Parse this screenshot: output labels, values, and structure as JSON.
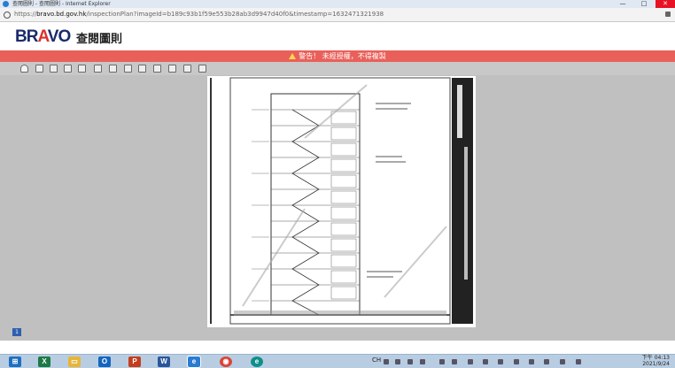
{
  "window": {
    "title": "查閱圖則 - 查閱圖則 - Internet Explorer",
    "controls": [
      "—",
      "□",
      "✕"
    ]
  },
  "address": {
    "url_prefix": "https://",
    "url_domain": "bravo.bd.gov.hk",
    "url_path": "/inspectionPlan?imageId=b189c93b1f59e553b28ab3d9947d40f0&timestamp=1632471321938"
  },
  "header": {
    "logo_a": "BR",
    "logo_b": "A",
    "logo_c": "VO",
    "site_name": "查閱圖則"
  },
  "warning": {
    "text": "警告！ 未經授權，不得複製"
  },
  "toolbar": {
    "tools": [
      "hand-tool",
      "select-tool",
      "zoom-in-tool",
      "zoom-out-tool",
      "pan-tool",
      "fit-width-tool",
      "fit-page-tool",
      "actual-size-tool",
      "magnify-tool",
      "rotate-left-tool",
      "rotate-right-tool",
      "print-tool",
      "help-tool"
    ]
  },
  "viewer": {
    "page_indicator": "1"
  },
  "taskbar": {
    "apps": [
      {
        "name": "start",
        "label": "⊞",
        "color": "#1f6fbf"
      },
      {
        "name": "excel",
        "label": "X",
        "color": "#1d7a45"
      },
      {
        "name": "file-explorer",
        "label": "▭",
        "color": "#e6b53a"
      },
      {
        "name": "outlook",
        "label": "O",
        "color": "#1565c0"
      },
      {
        "name": "powerpoint",
        "label": "P",
        "color": "#c43e1c"
      },
      {
        "name": "word",
        "label": "W",
        "color": "#2b579a"
      },
      {
        "name": "internet-explorer",
        "label": "e",
        "color": "#2a7bd1"
      },
      {
        "name": "chrome",
        "label": "◉",
        "color": "#db4437"
      },
      {
        "name": "edge",
        "label": "e",
        "color": "#0f8f8a"
      }
    ],
    "tray_text": "CH",
    "clock_time": "下午 04:13",
    "clock_date": "2021/9/24"
  }
}
